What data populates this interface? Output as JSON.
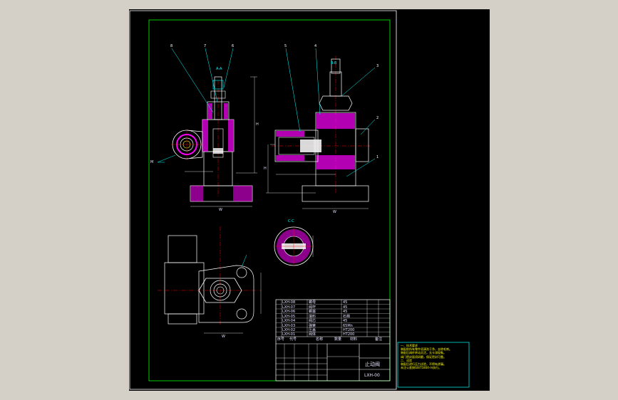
{
  "colors": {
    "background": "#d4d0c8",
    "viewport": "#000000",
    "outer_frame": "#ffffff",
    "inner_frame": "#00ff00",
    "outline": "#ffffff",
    "leader": "#00ffff",
    "section_hatch": "#ff00ff",
    "center_line": "#ff0000",
    "dimension": "#ffffff",
    "note_text": "#ffff00"
  },
  "view_labels": {
    "section_aa": "A-A",
    "section_bb": "B-B",
    "section_cc": "C-C"
  },
  "part_callouts": [
    "8",
    "7",
    "6",
    "5",
    "4",
    "3",
    "2",
    "1"
  ],
  "dimension_labels": {
    "front_height": "H",
    "front_width": "W",
    "side_width": "W",
    "side_height": "H",
    "thread": "M",
    "plan_width": "W"
  },
  "title_block": {
    "drawing_name": "止动阀",
    "drawing_code": "LXH-00"
  },
  "bom_rows": [
    {
      "code": "LXH-08",
      "name": "螺母",
      "material": "45"
    },
    {
      "code": "LXH-07",
      "name": "阀杆",
      "material": "45"
    },
    {
      "code": "LXH-06",
      "name": "螺塞",
      "material": "45"
    },
    {
      "code": "LXH-05",
      "name": "填料",
      "material": "石棉"
    },
    {
      "code": "LXH-04",
      "name": "阀芯",
      "material": "45"
    },
    {
      "code": "LXH-03",
      "name": "弹簧",
      "material": "65Mn"
    },
    {
      "code": "LXH-02",
      "name": "压盖",
      "material": "HT200"
    },
    {
      "code": "LXH-01",
      "name": "阀体",
      "material": "HT200"
    }
  ],
  "bom_header": [
    "序号",
    "代号",
    "名称",
    "数量",
    "材料",
    "备注"
  ],
  "tech_requirements": {
    "heading": "一、技术要求",
    "lines": [
      "装配前所有零件须清洗干净，去除毛刺。",
      "装配后阀杆转动灵活，无卡滞现象。",
      "阀门密封面须研磨，保证密封可靠。",
      "二、试验",
      "装配后进行压力试验，不得有渗漏。",
      "未注公差按GB/T1804-m执行。"
    ]
  }
}
